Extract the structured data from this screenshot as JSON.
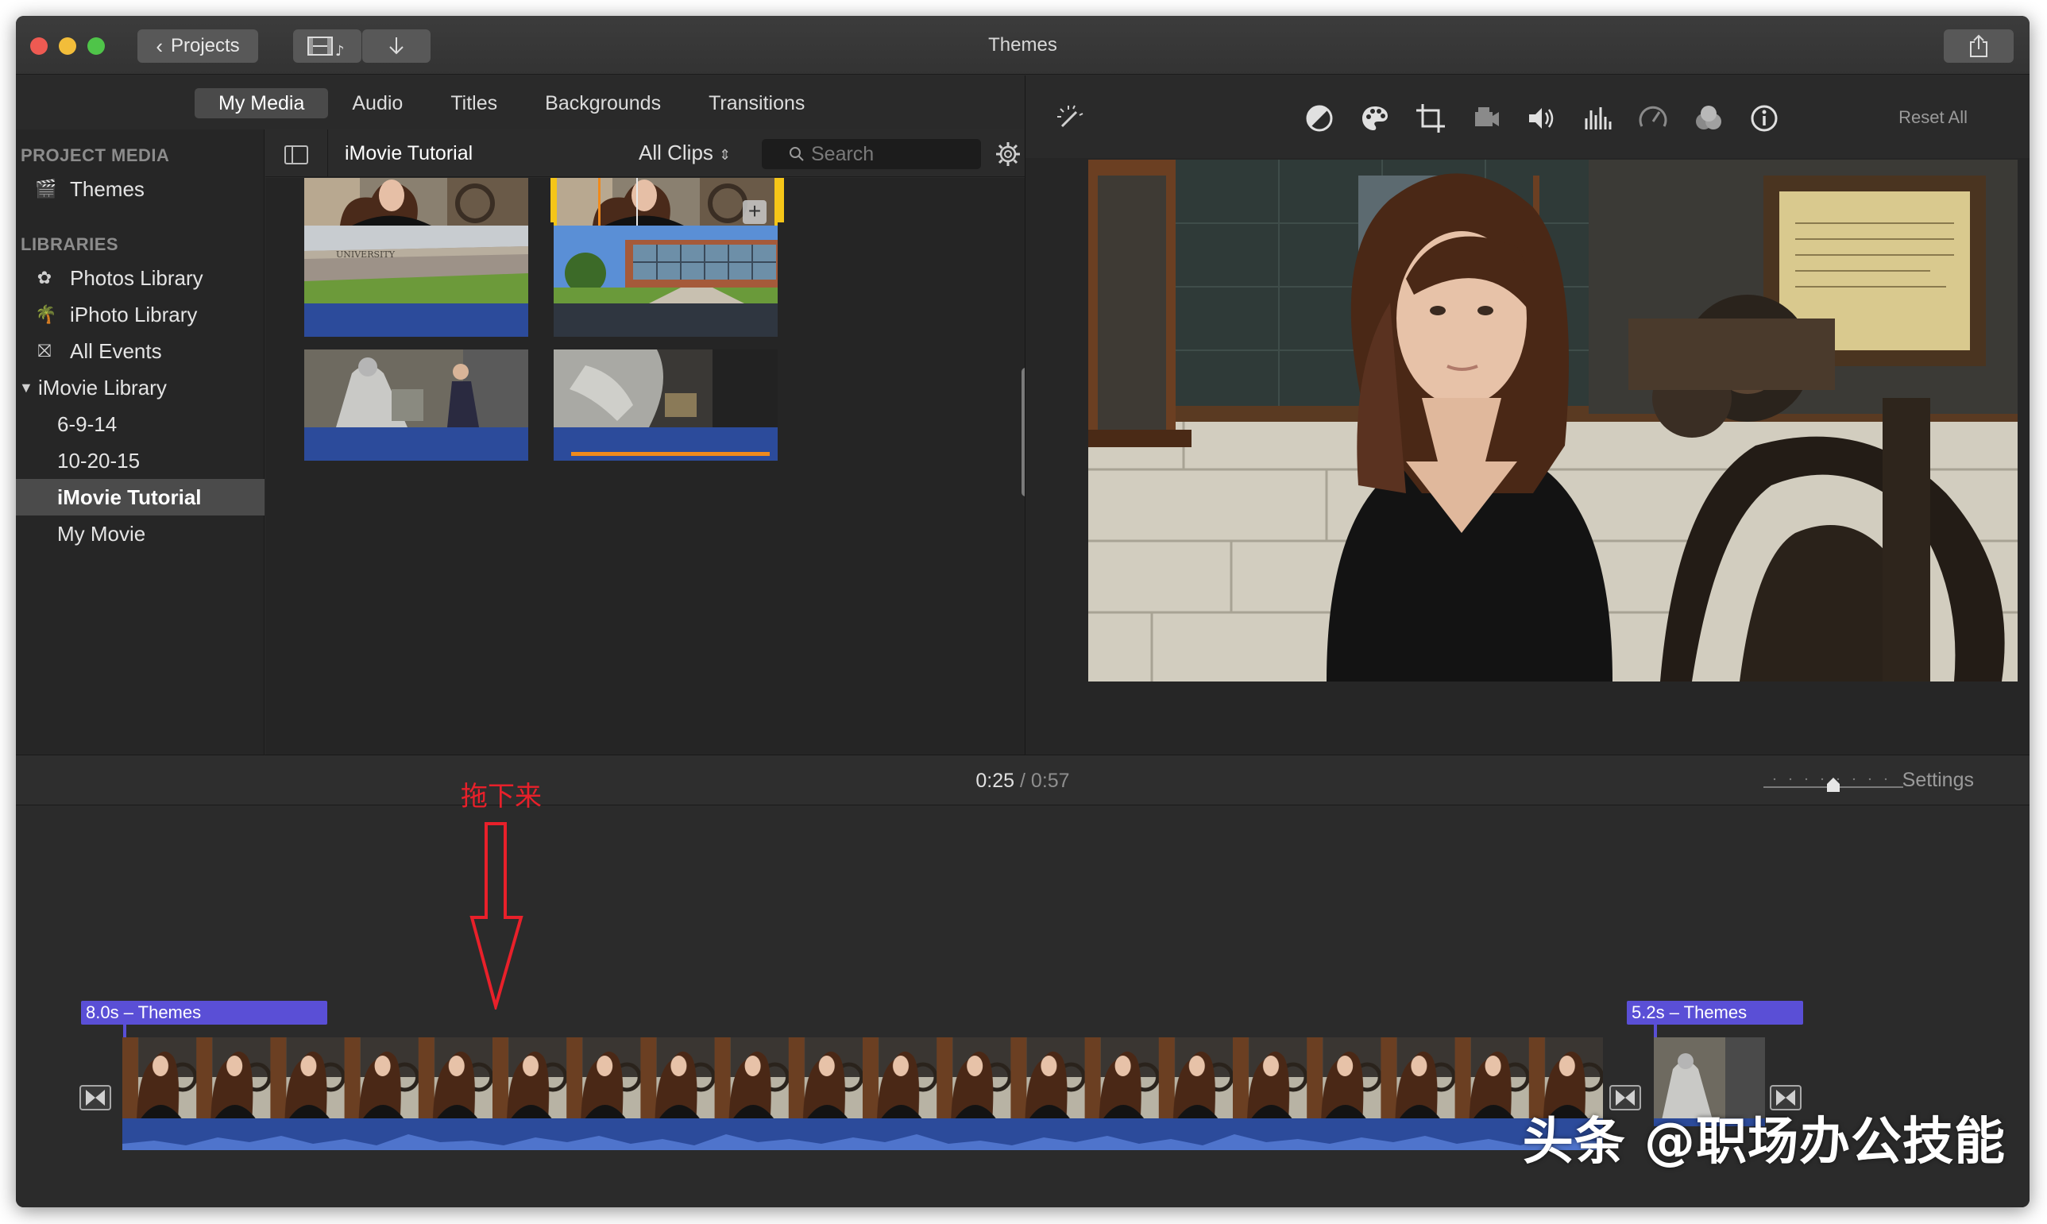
{
  "window": {
    "title": "Themes"
  },
  "toolbar": {
    "projects_label": "Projects"
  },
  "tabs": [
    {
      "label": "My Media",
      "active": true
    },
    {
      "label": "Audio",
      "active": false
    },
    {
      "label": "Titles",
      "active": false
    },
    {
      "label": "Backgrounds",
      "active": false
    },
    {
      "label": "Transitions",
      "active": false
    }
  ],
  "sidebar": {
    "project_media_header": "PROJECT MEDIA",
    "project_item": "Themes",
    "libraries_header": "LIBRARIES",
    "items": [
      {
        "label": "Photos Library"
      },
      {
        "label": "iPhoto Library"
      },
      {
        "label": "All Events"
      },
      {
        "label": "iMovie Library"
      },
      {
        "label": "6-9-14"
      },
      {
        "label": "10-20-15"
      },
      {
        "label": "iMovie Tutorial",
        "selected": true
      },
      {
        "label": "My Movie"
      }
    ]
  },
  "browser": {
    "event_name": "iMovie Tutorial",
    "filter_label": "All Clips",
    "search_placeholder": "Search"
  },
  "viewer": {
    "reset_all": "Reset All"
  },
  "timeline": {
    "current_time": "0:25",
    "separator": "/",
    "duration": "0:57",
    "settings_label": "Settings",
    "title_clip_1": "8.0s – Themes",
    "title_clip_2": "5.2s – Themes"
  },
  "annotation": {
    "text": "拖下来",
    "color": "#e8202a"
  },
  "watermark": "头条 @职场办公技能",
  "colors": {
    "title_chip": "#5a4fd6",
    "audio_wave": "#2c4b9b",
    "selection": "#f5c518",
    "playhead_orange": "#f08a1c"
  }
}
